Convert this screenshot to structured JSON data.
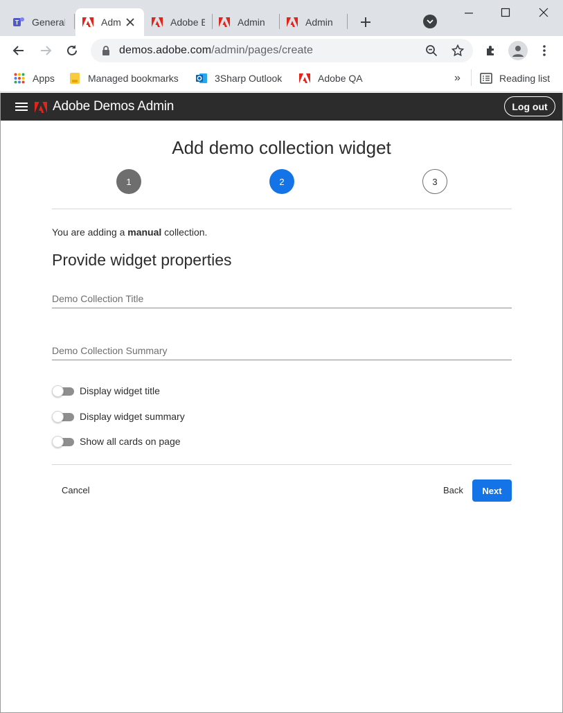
{
  "browser": {
    "tabs": [
      {
        "title": "General",
        "favicon": "teams-icon"
      },
      {
        "title": "Admin",
        "favicon": "adobe-icon",
        "active": true
      },
      {
        "title": "Adobe E",
        "favicon": "adobe-icon"
      },
      {
        "title": "Admin",
        "favicon": "adobe-icon"
      },
      {
        "title": "Admin",
        "favicon": "adobe-icon"
      }
    ],
    "url_host": "demos.adobe.com",
    "url_path": "/admin/pages/create",
    "bookmarks": [
      {
        "label": "Apps",
        "icon": "apps-grid-icon"
      },
      {
        "label": "Managed bookmarks",
        "icon": "folder-icon"
      },
      {
        "label": "3Sharp Outlook",
        "icon": "outlook-icon"
      },
      {
        "label": "Adobe QA",
        "icon": "adobe-icon"
      }
    ],
    "overflow": "»",
    "reading_list": "Reading list"
  },
  "app": {
    "title": "Adobe Demos Admin",
    "logout_label": "Log out"
  },
  "page": {
    "title": "Add demo collection widget",
    "steps": [
      "1",
      "2",
      "3"
    ],
    "current_step": 2,
    "intro_prefix": "You are adding a ",
    "intro_bold": "manual",
    "intro_suffix": " collection.",
    "section_title": "Provide widget properties",
    "fields": {
      "title_placeholder": "Demo Collection Title",
      "title_value": "",
      "summary_placeholder": "Demo Collection Summary",
      "summary_value": ""
    },
    "toggles": [
      {
        "label": "Display widget title",
        "on": false
      },
      {
        "label": "Display widget summary",
        "on": false
      },
      {
        "label": "Show all cards on page",
        "on": false
      }
    ],
    "cancel_label": "Cancel",
    "back_label": "Back",
    "next_label": "Next"
  },
  "colors": {
    "accent": "#1473e6",
    "appbar": "#2c2c2c",
    "adobe_red": "#e1251b"
  }
}
